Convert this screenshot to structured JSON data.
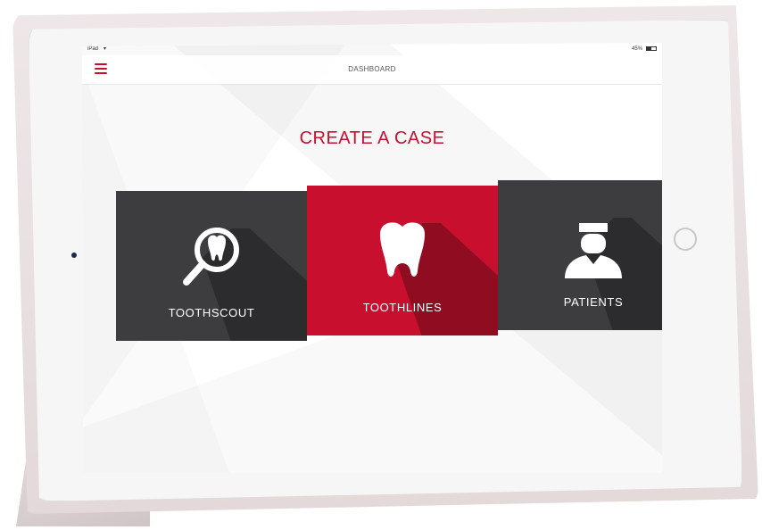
{
  "status_bar": {
    "device_name": "iPad",
    "wifi_icon": "wifi-icon",
    "battery_text": "45%"
  },
  "nav": {
    "menu_icon": "menu-icon",
    "title": "DASHBOARD"
  },
  "main": {
    "title": "CREATE A CASE",
    "tiles": [
      {
        "label": "TOOTHSCOUT",
        "icon": "magnifier-tooth-icon",
        "color": "#3d3d3f"
      },
      {
        "label": "TOOTHLINES",
        "icon": "tooth-icon",
        "color": "#c8102e"
      },
      {
        "label": "PATIENTS",
        "icon": "patient-icon",
        "color": "#3d3d3f"
      }
    ]
  },
  "colors": {
    "accent": "#c8102e",
    "tile_dark": "#3d3d3f"
  }
}
